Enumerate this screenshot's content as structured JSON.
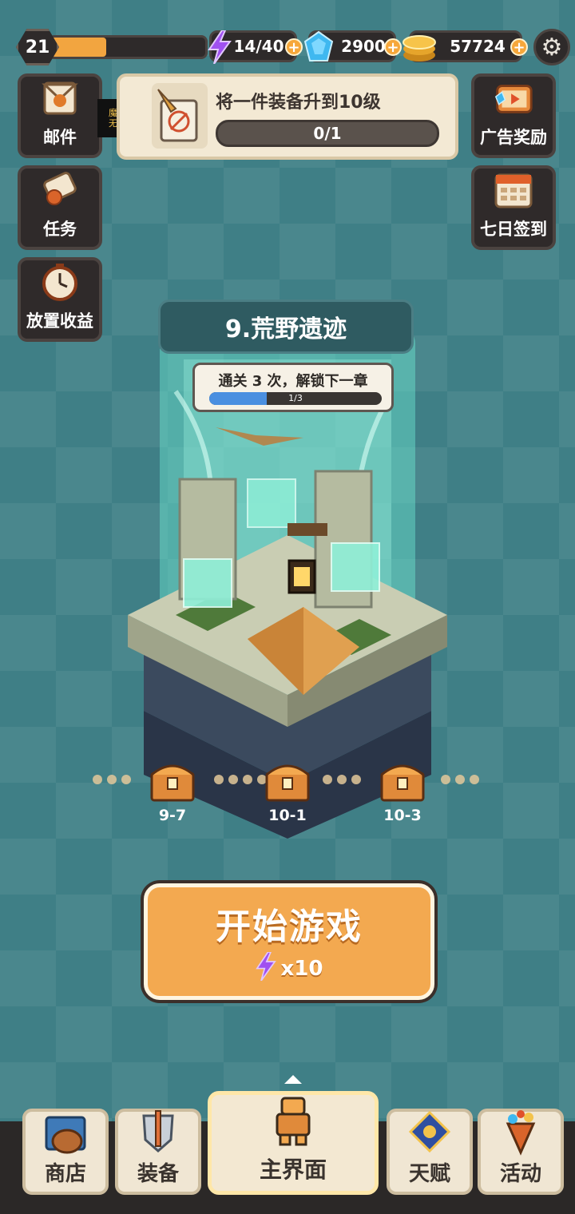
{
  "player": {
    "level": "21",
    "xp_progress": 0.36
  },
  "resources": {
    "energy": "14/40",
    "gems": "2900",
    "coins": "57724"
  },
  "side_left": [
    {
      "label": "邮件",
      "icon": "mail-icon"
    },
    {
      "label": "任务",
      "icon": "quest-scroll-icon"
    },
    {
      "label": "放置收益",
      "icon": "idle-clock-icon"
    }
  ],
  "side_right": [
    {
      "label": "广告奖励",
      "icon": "ad-tv-icon"
    },
    {
      "label": "七日签到",
      "icon": "calendar-icon"
    }
  ],
  "logo": {
    "line1": "魔武",
    "line2": "无限"
  },
  "quest": {
    "title": "将一件装备升到10级",
    "progress": "0/1"
  },
  "chapter": {
    "title": "9.荒野遗迹",
    "unlock_tip": "通关 3 次，解锁下一章",
    "unlock_progress": "1/3",
    "unlock_fraction": 0.333
  },
  "stages": [
    {
      "label": "9-7"
    },
    {
      "label": "10-1"
    },
    {
      "label": "10-3"
    }
  ],
  "start": {
    "label": "开始游戏",
    "cost": "x10"
  },
  "nav": {
    "shop": "商店",
    "equipment": "装备",
    "home": "主界面",
    "talent": "天赋",
    "events": "活动"
  },
  "colors": {
    "accent": "#f3a950",
    "background": "#3f7f86",
    "energy": "#a050f0",
    "gem": "#3fb8f0"
  }
}
